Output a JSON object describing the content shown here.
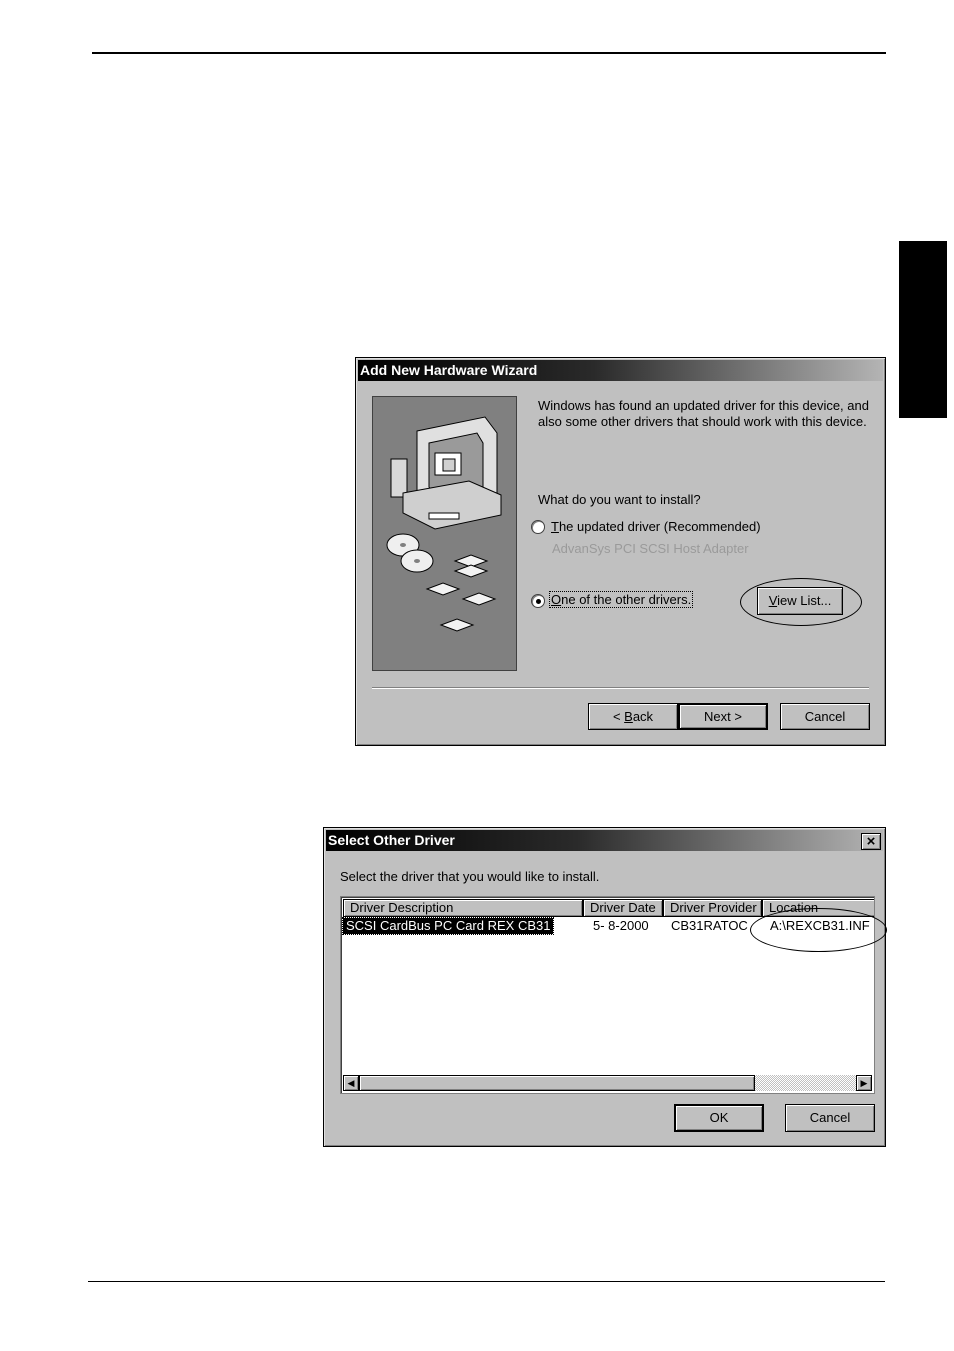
{
  "wizard": {
    "title": "Add New Hardware Wizard",
    "message_line1": "Windows has found an updated driver for this device, and",
    "message_line2": "also some other drivers that should work with this device.",
    "question": "What do you want to install?",
    "option1_accel": "T",
    "option1_rest": "he updated driver (Recommended)",
    "option1_subtext": "AdvanSys PCI SCSI Host Adapter",
    "option2_accel": "O",
    "option2_rest": "ne of the other drivers.",
    "view_list_accel": "V",
    "view_list_rest": "iew List...",
    "back_prefix": "< ",
    "back_accel": "B",
    "back_rest": "ack",
    "next_label": "Next >",
    "cancel_label": "Cancel"
  },
  "select_driver": {
    "title": "Select Other Driver",
    "close_glyph": "×",
    "instruction": "Select the driver that you would like to install.",
    "columns": [
      "Driver Description",
      "Driver Date",
      "Driver Provider",
      "Location"
    ],
    "rows": [
      [
        "SCSI CardBus PC Card REX CB31",
        "5- 8-2000",
        "CB31RATOC",
        "A:\\REXCB31.INF"
      ]
    ],
    "ok_label": "OK",
    "cancel_label": "Cancel",
    "scroll_left_glyph": "◀",
    "scroll_right_glyph": "▶"
  }
}
